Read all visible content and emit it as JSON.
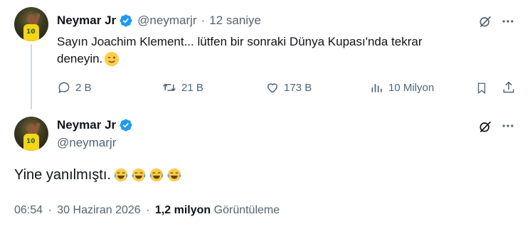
{
  "reply_tweet": {
    "name": "Neymar Jr",
    "handle": "@neymarjr",
    "separator": "·",
    "time": "12 saniye",
    "text_line1": "Sayın Joachim Klement... lütfen bir sonraki Dünya Kupası'nda tekrar",
    "text_line2": "deneyin.",
    "actions": {
      "replies": "2 B",
      "retweets": "21 B",
      "likes": "173 B",
      "views": "10 Milyon"
    }
  },
  "main_tweet": {
    "name": "Neymar Jr",
    "handle": "@neymarjr",
    "text": "Yine yanılmıştı.",
    "time": "06:54",
    "separator": "·",
    "date": "30 Haziran 2026",
    "separator2": "·",
    "views": "1,2 milyon",
    "views_label": "Görüntüleme"
  },
  "colors": {
    "verified": "#1d9bf0",
    "text": "#0f1419",
    "muted": "#536471",
    "thread_line": "#cfd9de"
  },
  "icons": [
    "verified-badge-icon",
    "grok-icon",
    "more-icon",
    "reply-icon",
    "retweet-icon",
    "like-icon",
    "views-icon",
    "bookmark-icon",
    "share-icon",
    "wink-emoji",
    "tears-of-joy-emoji"
  ]
}
